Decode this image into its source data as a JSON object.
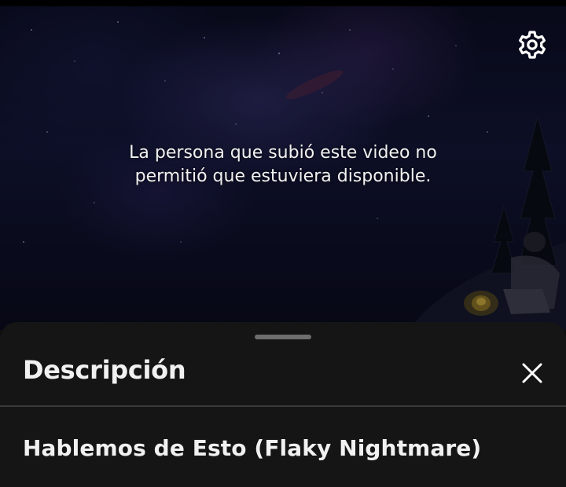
{
  "player": {
    "unavailable_message_line1": "La persona que subió este video no",
    "unavailable_message_line2": "permitió que estuviera disponible.",
    "settings_icon": "gear-icon"
  },
  "description_sheet": {
    "title": "Descripción",
    "close_icon": "close-icon",
    "video_title": "Hablemos de Esto (Flaky Nightmare)"
  },
  "colors": {
    "sheet_background": "#151515",
    "text_primary": "#f1f1f1",
    "divider": "#3a3a3a",
    "handle": "#6e6e6e"
  }
}
